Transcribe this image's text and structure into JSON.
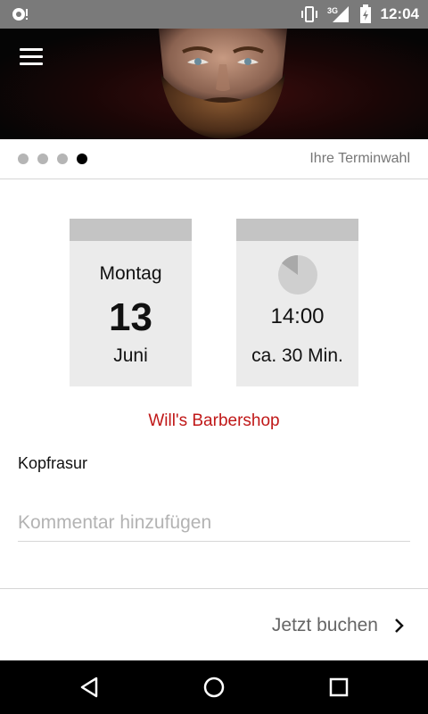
{
  "status_bar": {
    "time": "12:04",
    "network": "3G",
    "icons": [
      "notification-icon",
      "vibrate-icon",
      "signal-icon",
      "battery-icon"
    ]
  },
  "hero": {
    "menu_icon": "hamburger-menu-icon"
  },
  "steps": {
    "total": 4,
    "current": 4,
    "title": "Ihre Terminwahl"
  },
  "date_card": {
    "weekday": "Montag",
    "day": "13",
    "month": "Juni"
  },
  "time_card": {
    "icon": "clock-icon",
    "time": "14:00",
    "duration": "ca. 30 Min."
  },
  "shop_name": "Will's Barbershop",
  "service": "Kopfrasur",
  "comment": {
    "value": "",
    "placeholder": "Kommentar hinzufügen"
  },
  "book_button": {
    "label": "Jetzt buchen",
    "icon": "chevron-right-icon"
  },
  "colors": {
    "accent_red": "#c01818",
    "card_bg": "#ebebeb",
    "card_cap": "#c4c4c4",
    "status_bar": "#7a7a7a"
  }
}
